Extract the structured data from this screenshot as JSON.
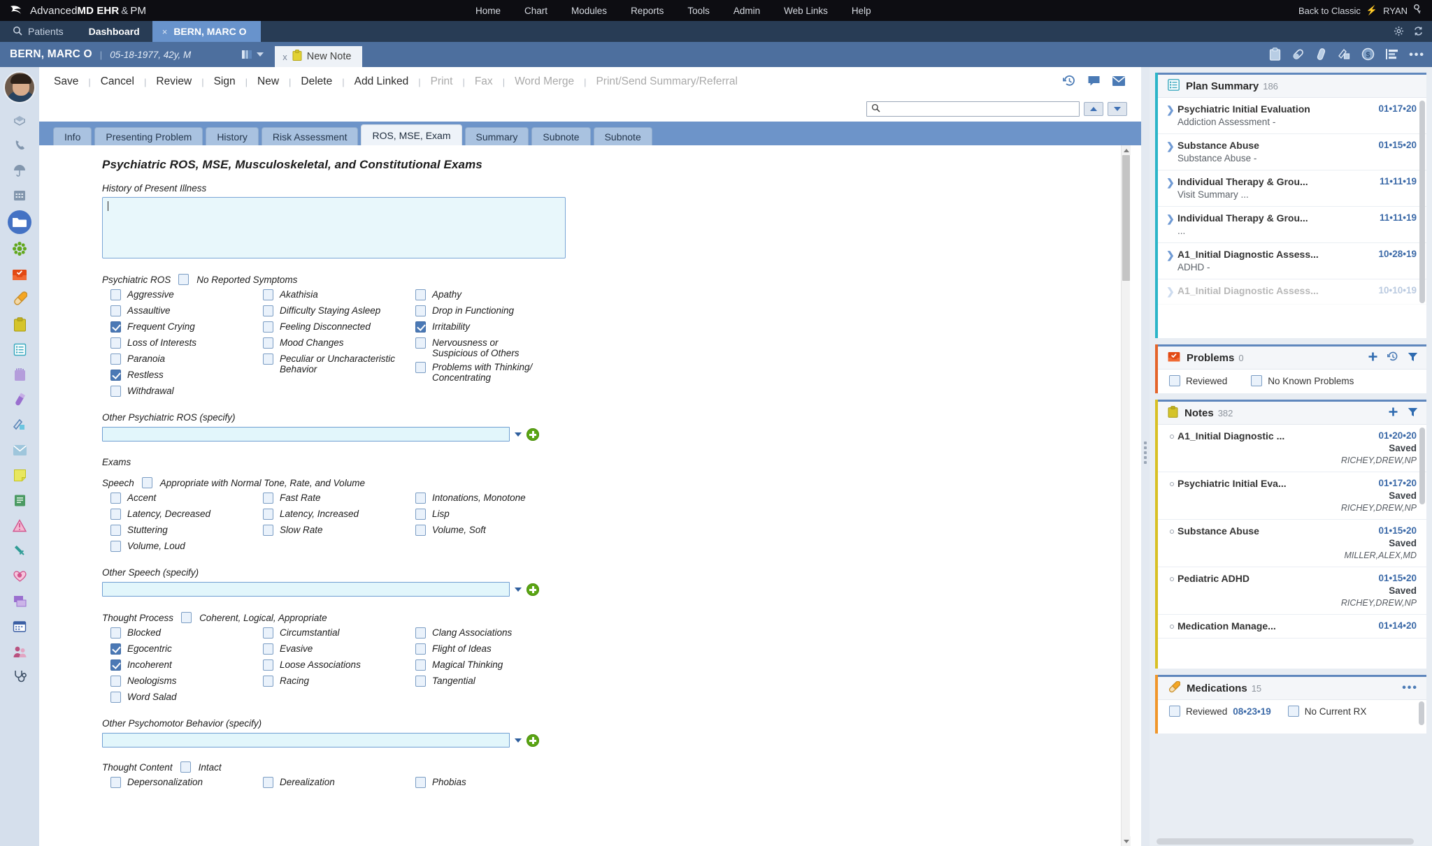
{
  "app": {
    "brand_pre": "Advanced",
    "brand_bold": "MD EHR",
    "brand_amp": "&",
    "brand_suffix": "PM",
    "logo_icon": "swoosh-logo-icon"
  },
  "topnav": {
    "items": [
      "Home",
      "Chart",
      "Modules",
      "Reports",
      "Tools",
      "Admin",
      "Web Links",
      "Help"
    ],
    "back_to_classic": "Back to Classic",
    "user": "RYAN",
    "key_icon": "key-icon",
    "bolt_icon": "bolt-icon"
  },
  "tabstrip": {
    "search_icon": "search-icon",
    "patients": "Patients",
    "dashboard": "Dashboard",
    "active_tab": "BERN, MARC O",
    "close_glyph": "×",
    "gear_icon": "gear-icon",
    "refresh_icon": "refresh-icon"
  },
  "patient": {
    "name": "BERN, MARC O",
    "demographics": "05-18-1977, 42y, M",
    "chart_selector_icon": "chart-color-icon",
    "note_tab": "New Note",
    "note_tab_icon": "clipboard-yellow-icon",
    "note_tab_close": "x",
    "header_icons": [
      "clipboard-icon",
      "pill-icon",
      "test-tube-icon",
      "imaging-icon",
      "dollar-coin-icon",
      "report-bars-icon",
      "more-ellipsis-icon"
    ]
  },
  "commandbar": {
    "buttons": [
      {
        "label": "Save",
        "disabled": false
      },
      {
        "label": "Cancel",
        "disabled": false
      },
      {
        "label": "Review",
        "disabled": false
      },
      {
        "label": "Sign",
        "disabled": false
      },
      {
        "label": "New",
        "disabled": false
      },
      {
        "label": "Delete",
        "disabled": false
      },
      {
        "label": "Add Linked",
        "disabled": false
      },
      {
        "label": "Print",
        "disabled": true
      },
      {
        "label": "Fax",
        "disabled": true
      },
      {
        "label": "Word Merge",
        "disabled": true
      },
      {
        "label": "Print/Send Summary/Referral",
        "disabled": true
      }
    ],
    "right_icons": [
      "history-icon",
      "comment-icon",
      "envelope-icon"
    ]
  },
  "search": {
    "value": "",
    "placeholder": "",
    "icon": "search-icon",
    "prev_label": "▲",
    "next_label": "▼"
  },
  "form_tabs": [
    {
      "label": "Info",
      "active": false
    },
    {
      "label": "Presenting Problem",
      "active": false
    },
    {
      "label": "History",
      "active": false
    },
    {
      "label": "Risk Assessment",
      "active": false
    },
    {
      "label": "ROS, MSE, Exam",
      "active": true
    },
    {
      "label": "Summary",
      "active": false
    },
    {
      "label": "Subnote",
      "active": false
    },
    {
      "label": "Subnote",
      "active": false
    }
  ],
  "form": {
    "title": "Psychiatric ROS, MSE, Musculoskeletal, and Constitutional Exams",
    "hpi_label": "History of Present Illness",
    "hpi_value": "",
    "exams_label": "Exams",
    "groups": [
      {
        "name": "Psychiatric ROS",
        "option_label": "No Reported Symptoms",
        "option_checked": false,
        "columns": [
          [
            {
              "label": "Aggressive",
              "checked": false
            },
            {
              "label": "Assaultive",
              "checked": false
            },
            {
              "label": "Frequent Crying",
              "checked": true
            },
            {
              "label": "Loss of Interests",
              "checked": false
            },
            {
              "label": "Paranoia",
              "checked": false
            },
            {
              "label": "Restless",
              "checked": true
            },
            {
              "label": "Withdrawal",
              "checked": false
            }
          ],
          [
            {
              "label": "Akathisia",
              "checked": false
            },
            {
              "label": "Difficulty Staying Asleep",
              "checked": false
            },
            {
              "label": "Feeling Disconnected",
              "checked": false
            },
            {
              "label": "Mood Changes",
              "checked": false
            },
            {
              "label": "Peculiar or Uncharacteristic Behavior",
              "checked": false
            }
          ],
          [
            {
              "label": "Apathy",
              "checked": false
            },
            {
              "label": "Drop in Functioning",
              "checked": false
            },
            {
              "label": "Irritability",
              "checked": true
            },
            {
              "label": "Nervousness or Suspicious of Others",
              "checked": false
            },
            {
              "label": "Problems with Thinking/ Concentrating",
              "checked": false
            }
          ]
        ],
        "specify_label": "Other Psychiatric ROS (specify)",
        "specify_value": ""
      },
      {
        "name": "Speech",
        "option_label": "Appropriate with Normal Tone, Rate, and Volume",
        "option_checked": false,
        "columns": [
          [
            {
              "label": "Accent",
              "checked": false
            },
            {
              "label": "Latency, Decreased",
              "checked": false
            },
            {
              "label": "Stuttering",
              "checked": false
            },
            {
              "label": "Volume, Loud",
              "checked": false
            }
          ],
          [
            {
              "label": "Fast Rate",
              "checked": false
            },
            {
              "label": "Latency, Increased",
              "checked": false
            },
            {
              "label": "Slow Rate",
              "checked": false
            }
          ],
          [
            {
              "label": "Intonations, Monotone",
              "checked": false
            },
            {
              "label": "Lisp",
              "checked": false
            },
            {
              "label": "Volume, Soft",
              "checked": false
            }
          ]
        ],
        "specify_label": "Other Speech (specify)",
        "specify_value": ""
      },
      {
        "name": "Thought Process",
        "option_label": "Coherent, Logical, Appropriate",
        "option_checked": false,
        "columns": [
          [
            {
              "label": "Blocked",
              "checked": false
            },
            {
              "label": "Egocentric",
              "checked": true
            },
            {
              "label": "Incoherent",
              "checked": true
            },
            {
              "label": "Neologisms",
              "checked": false
            },
            {
              "label": "Word Salad",
              "checked": false
            }
          ],
          [
            {
              "label": "Circumstantial",
              "checked": false
            },
            {
              "label": "Evasive",
              "checked": false
            },
            {
              "label": "Loose Associations",
              "checked": false
            },
            {
              "label": "Racing",
              "checked": false
            }
          ],
          [
            {
              "label": "Clang Associations",
              "checked": false
            },
            {
              "label": "Flight of Ideas",
              "checked": false
            },
            {
              "label": "Magical Thinking",
              "checked": false
            },
            {
              "label": "Tangential",
              "checked": false
            }
          ]
        ],
        "specify_label": "Other Psychomotor Behavior (specify)",
        "specify_value": ""
      },
      {
        "name": "Thought Content",
        "option_label": "Intact",
        "option_checked": false,
        "columns": [
          [
            {
              "label": "Depersonalization",
              "checked": false
            }
          ],
          [
            {
              "label": "Derealization",
              "checked": false
            }
          ],
          [
            {
              "label": "Phobias",
              "checked": false
            }
          ]
        ],
        "specify_label": "",
        "specify_value": ""
      }
    ]
  },
  "sidebar": {
    "plan_summary": {
      "icon": "plan-list-icon",
      "title": "Plan Summary",
      "count": "186",
      "items": [
        {
          "title": "Psychiatric Initial Evaluation",
          "sub": "Addiction Assessment -",
          "date": "01•17•20"
        },
        {
          "title": "Substance Abuse",
          "sub": "Substance Abuse -",
          "date": "01•15•20"
        },
        {
          "title": "Individual Therapy & Grou...",
          "sub": "Visit Summary  ...",
          "date": "11•11•19"
        },
        {
          "title": "Individual Therapy & Grou...",
          "sub": "...",
          "date": "11•11•19"
        },
        {
          "title": "A1_Initial Diagnostic Assess...",
          "sub": "ADHD -",
          "date": "10•28•19"
        },
        {
          "title": "A1_Initial Diagnostic Assess...",
          "sub": "",
          "date": "10•10•19"
        }
      ]
    },
    "problems": {
      "icon": "problems-inbox-icon",
      "title": "Problems",
      "count": "0",
      "add_icon": "plus-icon",
      "history_icon": "history-icon",
      "filter_icon": "filter-icon",
      "reviewed_label": "Reviewed",
      "reviewed_checked": false,
      "none_label": "No Known Problems",
      "none_checked": false
    },
    "notes": {
      "icon": "notes-clipboard-icon",
      "title": "Notes",
      "count": "382",
      "add_icon": "plus-icon",
      "filter_icon": "filter-icon",
      "items": [
        {
          "title": "A1_Initial Diagnostic ...",
          "date": "01•20•20",
          "status": "Saved",
          "who": "RICHEY,DREW,NP"
        },
        {
          "title": "Psychiatric Initial Eva...",
          "date": "01•17•20",
          "status": "Saved",
          "who": "RICHEY,DREW,NP"
        },
        {
          "title": "Substance Abuse",
          "date": "01•15•20",
          "status": "Saved",
          "who": "MILLER,ALEX,MD"
        },
        {
          "title": "Pediatric ADHD",
          "date": "01•15•20",
          "status": "Saved",
          "who": "RICHEY,DREW,NP"
        },
        {
          "title": "Medication Manage...",
          "date": "01•14•20",
          "status": "",
          "who": ""
        }
      ]
    },
    "medications": {
      "icon": "pill-icon",
      "title": "Medications",
      "count": "15",
      "more_icon": "more-ellipsis-icon",
      "reviewed_label": "Reviewed",
      "reviewed_date": "08•23•19",
      "reviewed_checked": false,
      "none_label": "No Current RX",
      "none_checked": false
    }
  },
  "colors": {
    "brand_dark": "#0d0d12",
    "header_blue": "#4d6f9e",
    "tab_blue": "#6d94c9",
    "accent_teal": "#2bb5c8",
    "accent_orange": "#e4642a",
    "accent_yellow": "#d8c024",
    "accent_gold": "#f0962a",
    "checked_blue": "#4b79b5",
    "green_plus": "#5aa513"
  }
}
